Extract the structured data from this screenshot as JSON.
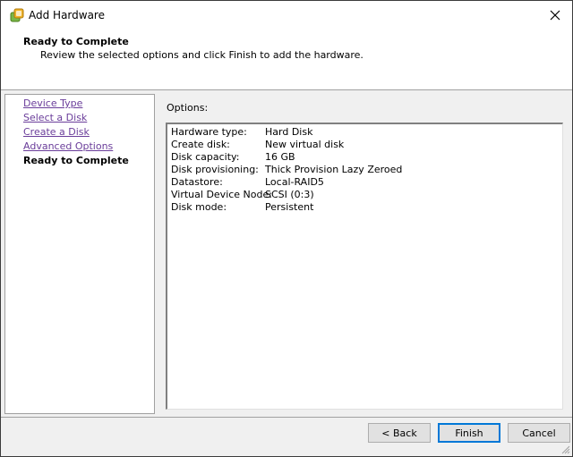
{
  "window": {
    "title": "Add Hardware",
    "icon": "vm-hardware-icon"
  },
  "header": {
    "title": "Ready to Complete",
    "subtitle": "Review the selected options and click Finish to add the hardware."
  },
  "nav": {
    "items": [
      {
        "label": "Device Type",
        "state": "link"
      },
      {
        "label": "Select a Disk",
        "state": "link"
      },
      {
        "label": "Create a Disk",
        "state": "link"
      },
      {
        "label": "Advanced Options",
        "state": "link"
      },
      {
        "label": "Ready to Complete",
        "state": "current"
      }
    ]
  },
  "options": {
    "label": "Options:",
    "rows": [
      {
        "key": "Hardware type:",
        "value": "Hard Disk"
      },
      {
        "key": "Create disk:",
        "value": "New virtual disk"
      },
      {
        "key": "Disk capacity:",
        "value": "16 GB"
      },
      {
        "key": "Disk provisioning:",
        "value": "Thick Provision Lazy Zeroed"
      },
      {
        "key": "Datastore:",
        "value": "Local-RAID5"
      },
      {
        "key": "Virtual Device Node:",
        "value": "SCSI (0:3)"
      },
      {
        "key": "Disk mode:",
        "value": "Persistent"
      }
    ]
  },
  "buttons": {
    "back": "< Back",
    "finish": "Finish",
    "cancel": "Cancel"
  },
  "colors": {
    "link": "#6a3d9a",
    "accent": "#0078d7",
    "icon_green": "#5a9a1e",
    "icon_orange": "#e8a317"
  }
}
